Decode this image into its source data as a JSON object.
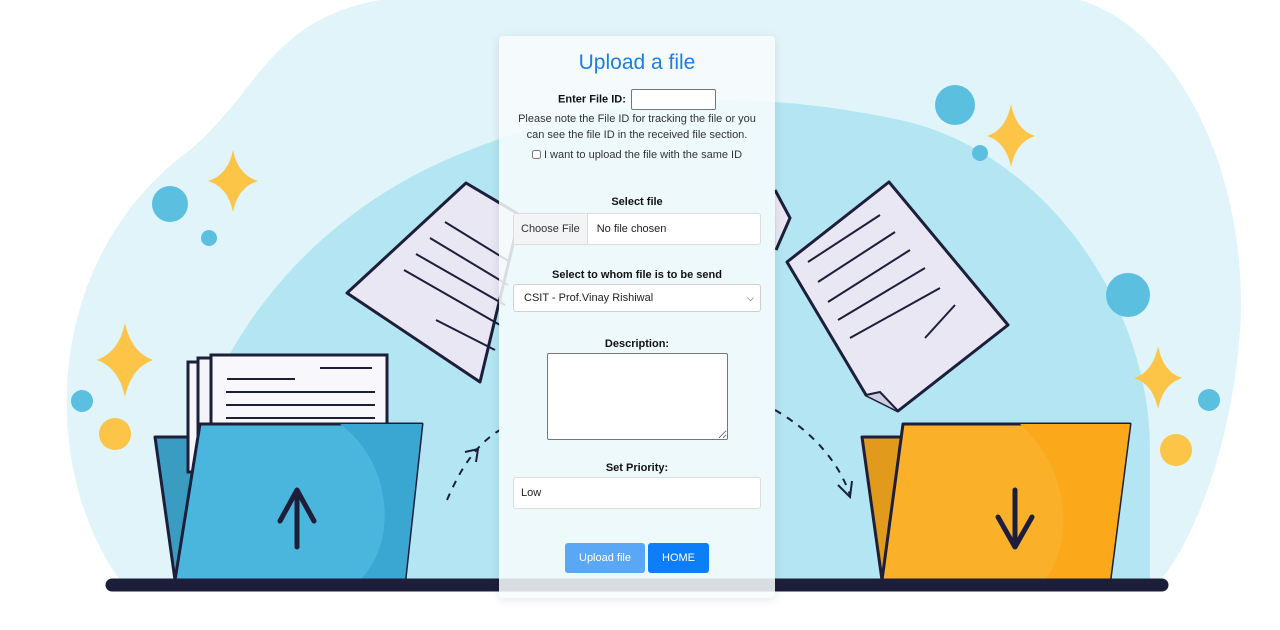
{
  "page": {
    "title": "Upload a file"
  },
  "file_id": {
    "label": "Enter File ID:",
    "value": ""
  },
  "note": "Please note the File ID for tracking the file or you can see the file ID in the received file section.",
  "same_id": {
    "label": "I want to upload the file with the same ID",
    "checked": false
  },
  "select_file": {
    "label": "Select file",
    "button": "Choose File",
    "status": "No file chosen"
  },
  "recipient": {
    "label": "Select to whom file is to be send",
    "selected": "CSIT - Prof.Vinay Rishiwal"
  },
  "description": {
    "label": "Description:",
    "value": ""
  },
  "priority": {
    "label": "Set Priority:",
    "value": "Low"
  },
  "buttons": {
    "upload": "Upload file",
    "home": "HOME"
  },
  "colors": {
    "title": "#1e7ee0",
    "upload_button": "#5aa7f5",
    "home_button": "#0d7ef9",
    "left_folder": "#4ab6dd",
    "right_folder": "#fbb02a",
    "background_blob": "#b3e6f2"
  }
}
